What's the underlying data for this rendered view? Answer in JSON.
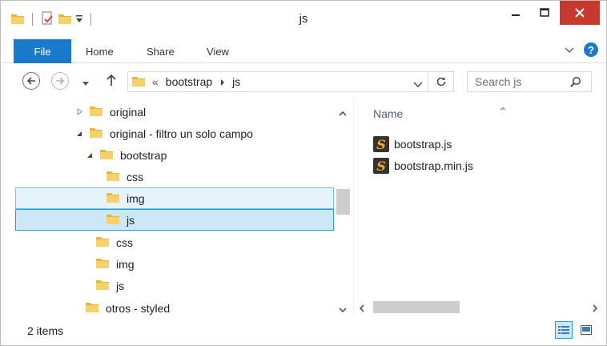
{
  "window": {
    "title": "js"
  },
  "ribbon": {
    "tabs": [
      {
        "label": "File"
      },
      {
        "label": "Home"
      },
      {
        "label": "Share"
      },
      {
        "label": "View"
      }
    ]
  },
  "address": {
    "overflow": "«",
    "crumbs": [
      "bootstrap",
      "js"
    ]
  },
  "search": {
    "placeholder": "Search js"
  },
  "tree": {
    "items": [
      {
        "label": "original",
        "level": 1,
        "expander": "collapsed",
        "state": ""
      },
      {
        "label": "original - filtro un solo campo",
        "level": 1,
        "expander": "expanded",
        "state": ""
      },
      {
        "label": "bootstrap",
        "level": 2,
        "expander": "expanded",
        "state": ""
      },
      {
        "label": "css",
        "level": 3,
        "expander": "none",
        "state": ""
      },
      {
        "label": "img",
        "level": 3,
        "expander": "none",
        "state": "hover"
      },
      {
        "label": "js",
        "level": 3,
        "expander": "none",
        "state": "selected"
      },
      {
        "label": "css",
        "level": 2,
        "expander": "none",
        "state": ""
      },
      {
        "label": "img",
        "level": 2,
        "expander": "none",
        "state": ""
      },
      {
        "label": "js",
        "level": 2,
        "expander": "none",
        "state": ""
      },
      {
        "label": "otros - styled",
        "level": 1,
        "expander": "none",
        "state": ""
      }
    ]
  },
  "content": {
    "column_header": "Name",
    "files": [
      {
        "name": "bootstrap.js",
        "icon": "sublime-text-file-icon"
      },
      {
        "name": "bootstrap.min.js",
        "icon": "sublime-text-file-icon"
      }
    ]
  },
  "status": {
    "item_count": "2 items"
  },
  "colors": {
    "accent": "#1979ca",
    "close": "#c7392e",
    "selected_bg": "#cce8f6",
    "selected_border": "#26a0da",
    "hover_bg": "#e5f3fb",
    "folder": "#f3c54f"
  }
}
